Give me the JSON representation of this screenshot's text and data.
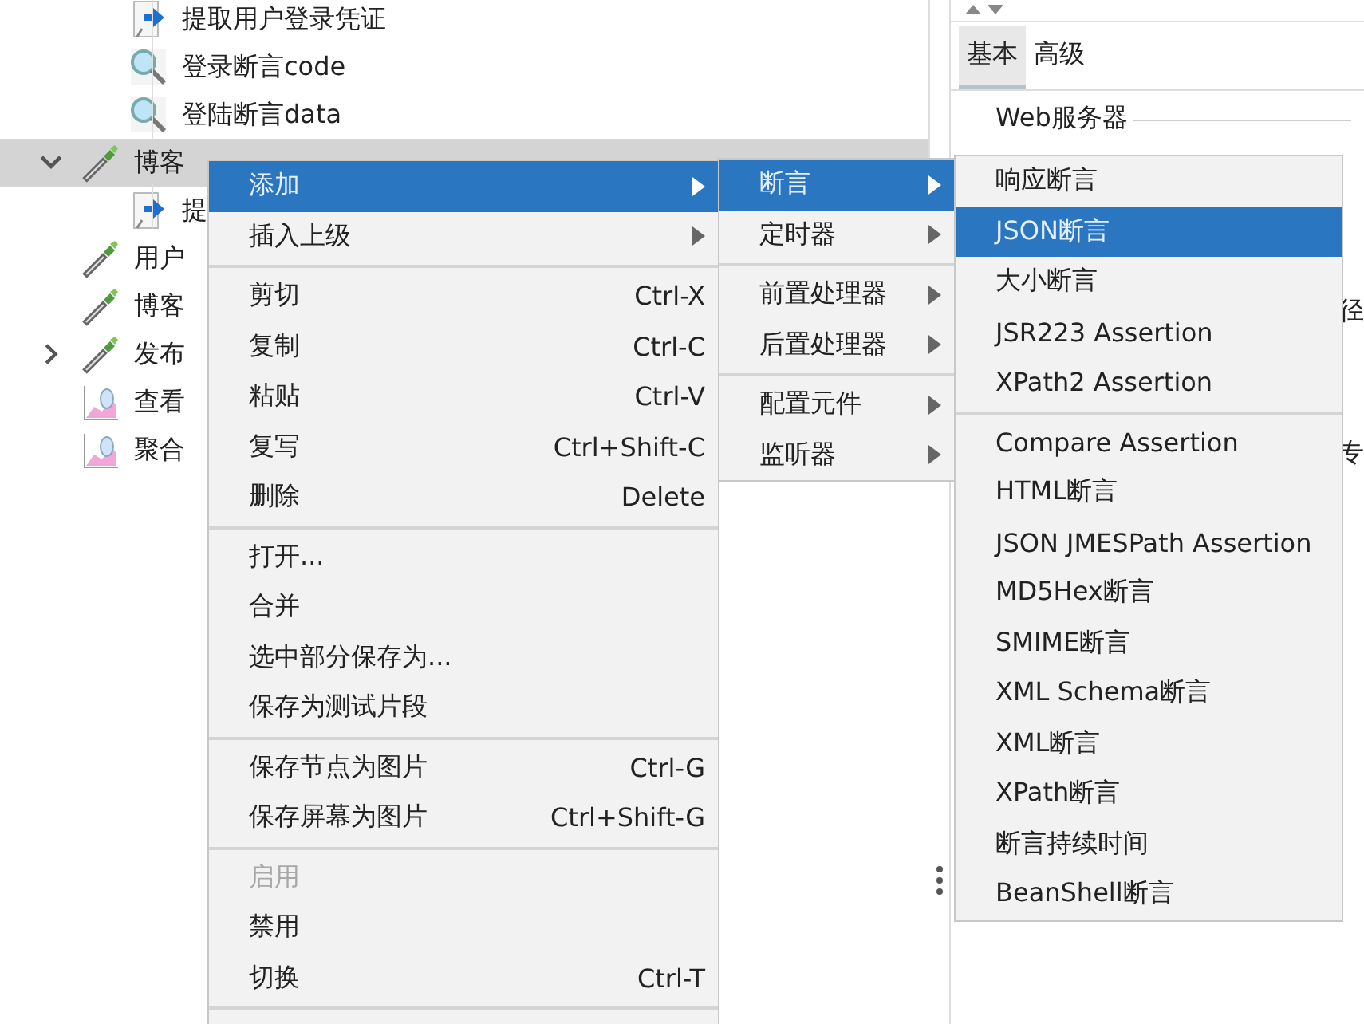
{
  "tree": {
    "continued_children": [
      {
        "label": "提取用户登录凭证",
        "kind": "extractor",
        "selected": false
      },
      {
        "label": "登录断言code",
        "kind": "assertion",
        "selected": false
      },
      {
        "label": "登陆断言data",
        "kind": "assertion",
        "selected": false
      }
    ],
    "items": [
      {
        "label": "博客",
        "kind": "sampler",
        "selected": true,
        "expanded": true,
        "children": [
          {
            "label": "提",
            "kind": "extractor",
            "selected": false
          }
        ]
      },
      {
        "label": "用户",
        "kind": "sampler",
        "selected": false
      },
      {
        "label": "博客",
        "kind": "sampler",
        "selected": false
      },
      {
        "label": "发布",
        "kind": "sampler",
        "selected": false,
        "expanded": false
      },
      {
        "label": "查看",
        "kind": "listener",
        "selected": false
      },
      {
        "label": "聚合",
        "kind": "listener",
        "selected": false
      }
    ]
  },
  "editor": {
    "tabs": [
      {
        "label": "基本",
        "selected": true
      },
      {
        "label": "高级",
        "selected": false
      }
    ],
    "group_title": "Web服务器",
    "fragments": [
      "径",
      "专"
    ]
  },
  "context_menu": [
    {
      "kind": "submenu",
      "label": "添加",
      "selected": true,
      "disabled": false
    },
    {
      "kind": "submenu",
      "label": "插入上级",
      "selected": false,
      "disabled": false
    },
    {
      "kind": "separator"
    },
    {
      "kind": "command",
      "label": "剪切",
      "shortcut": "Ctrl-X",
      "selected": false,
      "disabled": false
    },
    {
      "kind": "command",
      "label": "复制",
      "shortcut": "Ctrl-C",
      "selected": false,
      "disabled": false
    },
    {
      "kind": "command",
      "label": "粘贴",
      "shortcut": "Ctrl-V",
      "selected": false,
      "disabled": false
    },
    {
      "kind": "command",
      "label": "复写",
      "shortcut": "Ctrl+Shift-C",
      "selected": false,
      "disabled": false
    },
    {
      "kind": "command",
      "label": "删除",
      "shortcut": "Delete",
      "selected": false,
      "disabled": false
    },
    {
      "kind": "separator"
    },
    {
      "kind": "command",
      "label": "打开...",
      "selected": false,
      "disabled": false
    },
    {
      "kind": "command",
      "label": "合并",
      "selected": false,
      "disabled": false
    },
    {
      "kind": "command",
      "label": "选中部分保存为...",
      "selected": false,
      "disabled": false
    },
    {
      "kind": "command",
      "label": "保存为测试片段",
      "selected": false,
      "disabled": false
    },
    {
      "kind": "separator"
    },
    {
      "kind": "command",
      "label": "保存节点为图片",
      "shortcut": "Ctrl-G",
      "selected": false,
      "disabled": false
    },
    {
      "kind": "command",
      "label": "保存屏幕为图片",
      "shortcut": "Ctrl+Shift-G",
      "selected": false,
      "disabled": false
    },
    {
      "kind": "separator"
    },
    {
      "kind": "command",
      "label": "启用",
      "selected": false,
      "disabled": true
    },
    {
      "kind": "command",
      "label": "禁用",
      "selected": false,
      "disabled": false
    },
    {
      "kind": "command",
      "label": "切换",
      "shortcut": "Ctrl-T",
      "selected": false,
      "disabled": false
    },
    {
      "kind": "separator"
    }
  ],
  "add_submenu": [
    {
      "kind": "submenu",
      "label": "断言",
      "selected": true
    },
    {
      "kind": "submenu",
      "label": "定时器",
      "selected": false
    },
    {
      "kind": "separator"
    },
    {
      "kind": "submenu",
      "label": "前置处理器",
      "selected": false
    },
    {
      "kind": "submenu",
      "label": "后置处理器",
      "selected": false
    },
    {
      "kind": "separator"
    },
    {
      "kind": "submenu",
      "label": "配置元件",
      "selected": false
    },
    {
      "kind": "submenu",
      "label": "监听器",
      "selected": false
    }
  ],
  "assertion_submenu": [
    {
      "kind": "command",
      "label": "响应断言",
      "selected": false
    },
    {
      "kind": "command",
      "label": "JSON断言",
      "selected": true
    },
    {
      "kind": "command",
      "label": "大小断言",
      "selected": false
    },
    {
      "kind": "command",
      "label": "JSR223 Assertion",
      "selected": false
    },
    {
      "kind": "command",
      "label": "XPath2 Assertion",
      "selected": false
    },
    {
      "kind": "separator"
    },
    {
      "kind": "command",
      "label": "Compare Assertion",
      "selected": false
    },
    {
      "kind": "command",
      "label": "HTML断言",
      "selected": false
    },
    {
      "kind": "command",
      "label": "JSON JMESPath Assertion",
      "selected": false
    },
    {
      "kind": "command",
      "label": "MD5Hex断言",
      "selected": false
    },
    {
      "kind": "command",
      "label": "SMIME断言",
      "selected": false
    },
    {
      "kind": "command",
      "label": "XML Schema断言",
      "selected": false
    },
    {
      "kind": "command",
      "label": "XML断言",
      "selected": false
    },
    {
      "kind": "command",
      "label": "XPath断言",
      "selected": false
    },
    {
      "kind": "command",
      "label": "断言持续时间",
      "selected": false
    },
    {
      "kind": "command",
      "label": "BeanShell断言",
      "selected": false
    }
  ]
}
